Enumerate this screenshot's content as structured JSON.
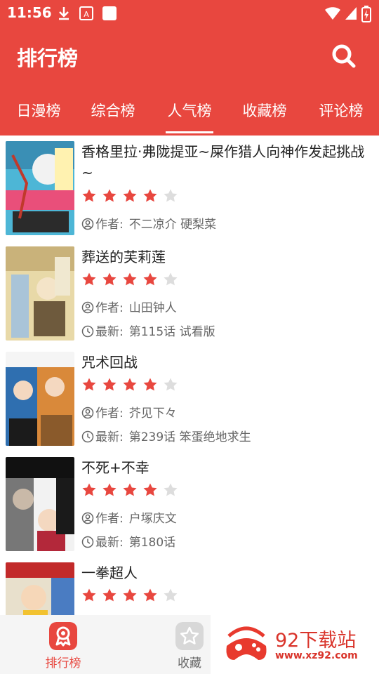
{
  "status_bar": {
    "time": "11:56"
  },
  "app_bar": {
    "title": "排行榜"
  },
  "tabs": [
    {
      "label": "日漫榜"
    },
    {
      "label": "综合榜"
    },
    {
      "label": "人气榜"
    },
    {
      "label": "收藏榜"
    },
    {
      "label": "评论榜"
    }
  ],
  "active_tab": "人气榜",
  "list": [
    {
      "title": "香格里拉·弗陇提亚~屎作猎人向神作发起挑战~",
      "rating": 4,
      "max_rating": 5,
      "author_label": "作者:",
      "author": "不二凉介 硬梨菜",
      "latest_label": "",
      "latest": ""
    },
    {
      "title": "葬送的芙莉莲",
      "rating": 4,
      "max_rating": 5,
      "author_label": "作者:",
      "author": "山田钟人",
      "latest_label": "最新:",
      "latest": "第115话 试看版"
    },
    {
      "title": "咒术回战",
      "rating": 4,
      "max_rating": 5,
      "author_label": "作者:",
      "author": "芥见下々",
      "latest_label": "最新:",
      "latest": "第239话 笨蛋绝地求生"
    },
    {
      "title": "不死+不幸",
      "rating": 4,
      "max_rating": 5,
      "author_label": "作者:",
      "author": "户塚庆文",
      "latest_label": "最新:",
      "latest": "第180话"
    },
    {
      "title": "一拳超人",
      "rating": 4,
      "max_rating": 5,
      "author_label": "",
      "author": "",
      "latest_label": "",
      "latest": ""
    }
  ],
  "bottom_nav": [
    {
      "label": "排行榜",
      "active": true
    },
    {
      "label": "收藏",
      "active": false
    }
  ],
  "watermark": {
    "brand": "92下载站",
    "url": "www.xz92.com"
  },
  "colors": {
    "accent": "#e8473f",
    "star_on": "#e8473f",
    "star_off": "#dddddd",
    "text": "#222222",
    "meta": "#666666"
  }
}
